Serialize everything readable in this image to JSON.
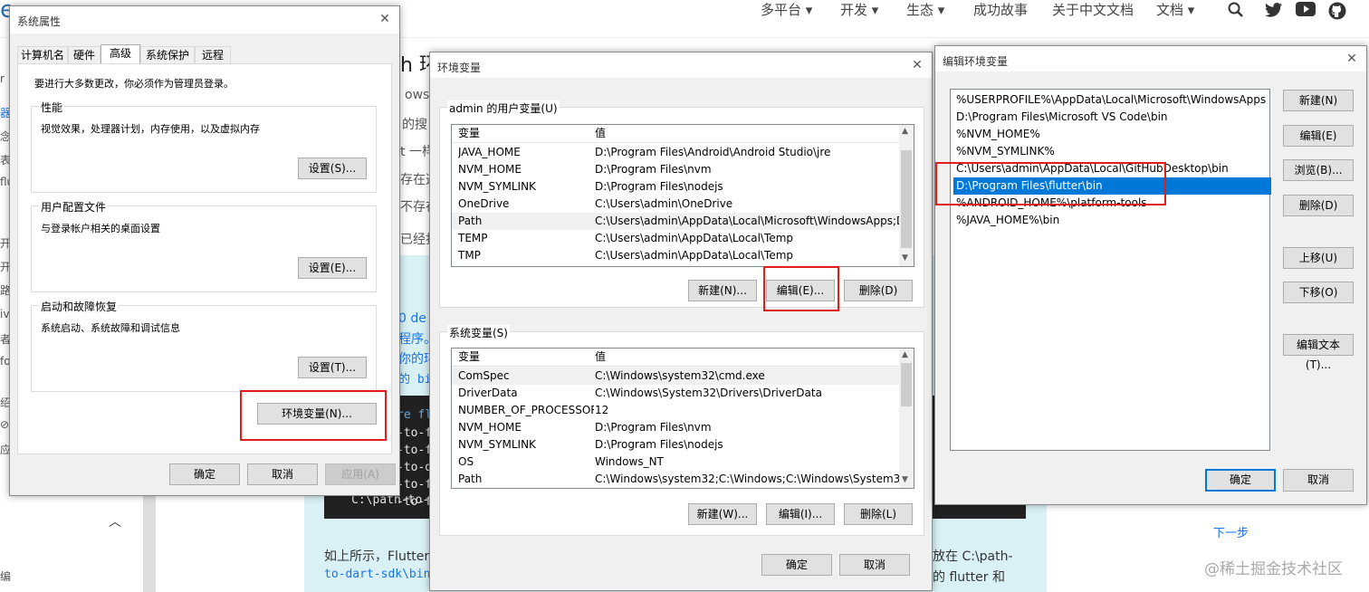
{
  "website": {
    "logo_char": "e",
    "nav": [
      "多平台 ▾",
      "开发 ▾",
      "生态 ▾",
      "成功故事",
      "关于中文文档",
      "文档 ▾"
    ],
    "nav_icons": [
      "search-icon",
      "twitter-icon",
      "youtube-icon",
      "github-icon"
    ],
    "heading_fragment": "h 环境变量",
    "text_fragments": [
      "ows",
      "的搜",
      "t 一样",
      "存在这",
      "不存在",
      "已经打"
    ],
    "panel_fragments": [
      "0 de",
      "程序。",
      "你的环",
      "的 bin"
    ],
    "code_lines": [
      "re fl",
      "-to-f",
      "-to-f",
      "-to-d",
      "-to-f",
      "-to-f",
      "C:\\path-to-f"
    ],
    "bottom_text_1": "如上所示，Flutter",
    "bottom_text_2": "to-dart-sdk\\bin\\",
    "bottom_text_3": "…已经排在前面",
    "right_text_1": "放在 C:\\path-",
    "right_text_2": "的 flutter 和",
    "next_link": "下一步",
    "watermark": "@稀土掘金技术社区",
    "left_chars": [
      "r",
      "器",
      "念",
      "表",
      "flu",
      "开发",
      "开始",
      "路径",
      "iv",
      "者",
      "fo",
      "绍",
      "⊘",
      "应",
      "编"
    ]
  },
  "sys_props": {
    "title": "系统属性",
    "tabs": [
      "计算机名",
      "硬件",
      "高级",
      "系统保护",
      "远程"
    ],
    "active_tab": "高级",
    "admin_note": "要进行大多数更改，你必须作为管理员登录。",
    "performance": {
      "label": "性能",
      "desc": "视觉效果，处理器计划，内存使用，以及虚拟内存",
      "button": "设置(S)..."
    },
    "profiles": {
      "label": "用户配置文件",
      "desc": "与登录帐户相关的桌面设置",
      "button": "设置(E)..."
    },
    "startup": {
      "label": "启动和故障恢复",
      "desc": "系统启动、系统故障和调试信息",
      "button": "设置(T)..."
    },
    "env_button": "环境变量(N)...",
    "ok": "确定",
    "cancel": "取消",
    "apply": "应用(A)"
  },
  "env_vars": {
    "title": "环境变量",
    "user_group": "admin 的用户变量(U)",
    "col_var": "变量",
    "col_val": "值",
    "user_rows": [
      {
        "name": "JAVA_HOME",
        "value": "D:\\Program Files\\Android\\Android Studio\\jre"
      },
      {
        "name": "NVM_HOME",
        "value": "D:\\Program Files\\nvm"
      },
      {
        "name": "NVM_SYMLINK",
        "value": "D:\\Program Files\\nodejs"
      },
      {
        "name": "OneDrive",
        "value": "C:\\Users\\admin\\OneDrive"
      },
      {
        "name": "Path",
        "value": "C:\\Users\\admin\\AppData\\Local\\Microsoft\\WindowsApps;D:\\P..."
      },
      {
        "name": "TEMP",
        "value": "C:\\Users\\admin\\AppData\\Local\\Temp"
      },
      {
        "name": "TMP",
        "value": "C:\\Users\\admin\\AppData\\Local\\Temp"
      }
    ],
    "user_buttons": [
      "新建(N)...",
      "编辑(E)...",
      "删除(D)"
    ],
    "sys_group": "系统变量(S)",
    "sys_rows": [
      {
        "name": "ComSpec",
        "value": "C:\\Windows\\system32\\cmd.exe"
      },
      {
        "name": "DriverData",
        "value": "C:\\Windows\\System32\\Drivers\\DriverData"
      },
      {
        "name": "NUMBER_OF_PROCESSORS",
        "value": "12"
      },
      {
        "name": "NVM_HOME",
        "value": "D:\\Program Files\\nvm"
      },
      {
        "name": "NVM_SYMLINK",
        "value": "D:\\Program Files\\nodejs"
      },
      {
        "name": "OS",
        "value": "Windows_NT"
      },
      {
        "name": "Path",
        "value": "C:\\Windows\\system32;C:\\Windows;C:\\Windows\\System32\\Wb..."
      }
    ],
    "sys_buttons": [
      "新建(W)...",
      "编辑(I)...",
      "删除(L)"
    ],
    "ok": "确定",
    "cancel": "取消"
  },
  "edit_env": {
    "title": "编辑环境变量",
    "items": [
      "%USERPROFILE%\\AppData\\Local\\Microsoft\\WindowsApps",
      "D:\\Program Files\\Microsoft VS Code\\bin",
      "%NVM_HOME%",
      "%NVM_SYMLINK%",
      "C:\\Users\\admin\\AppData\\Local\\GitHubDesktop\\bin",
      "D:\\Program Files\\flutter\\bin",
      "%ANDROID_HOME%\\platform-tools",
      "%JAVA_HOME%\\bin"
    ],
    "selected_index": 5,
    "buttons": [
      "新建(N)",
      "编辑(E)",
      "浏览(B)...",
      "删除(D)",
      "上移(U)",
      "下移(O)",
      "编辑文本(T)..."
    ],
    "ok": "确定",
    "cancel": "取消"
  },
  "colors": {
    "accent": "#0078d7",
    "highlight": "#e01e1e"
  }
}
